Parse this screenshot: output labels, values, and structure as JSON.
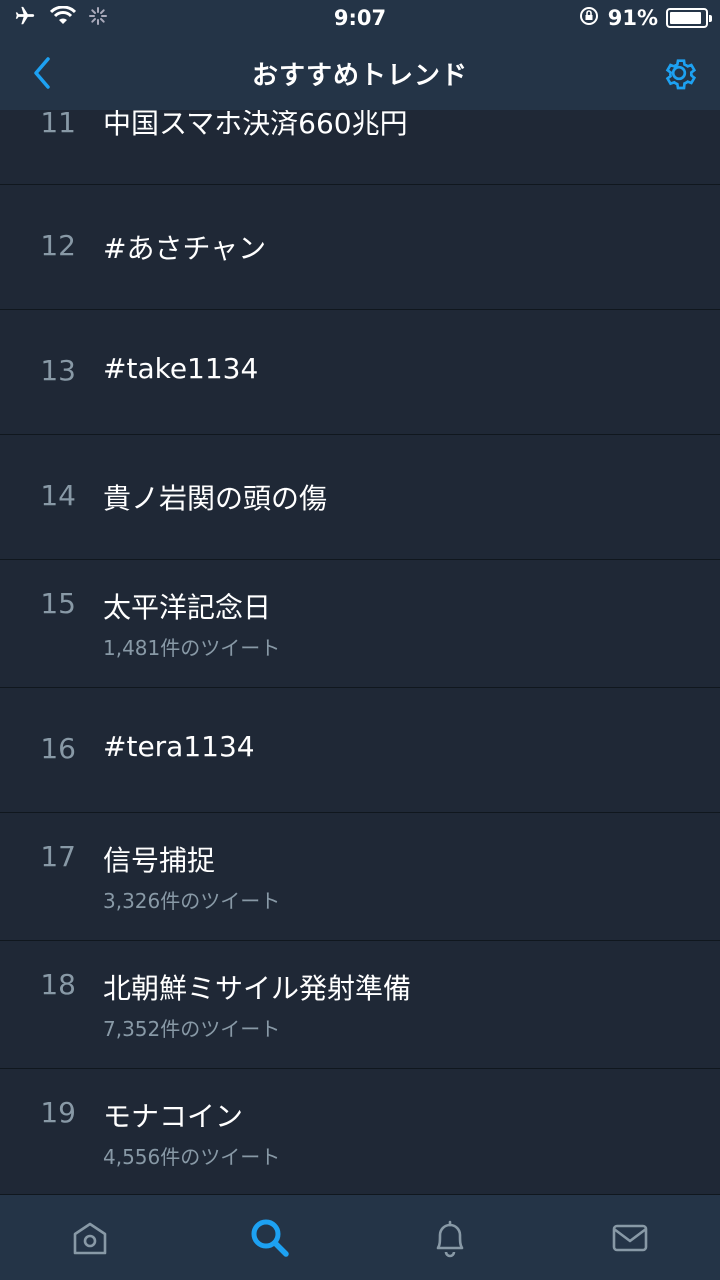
{
  "status_bar": {
    "time": "9:07",
    "battery_percent": "91%",
    "battery_level": 0.91,
    "icons": [
      "airplane-icon",
      "wifi-icon",
      "activity-spinner-icon",
      "orientation-lock-icon",
      "battery-icon"
    ]
  },
  "header": {
    "title": "おすすめトレンド",
    "back_icon": "chevron-left-icon",
    "settings_icon": "gear-icon",
    "accent_color": "#1da1f2"
  },
  "trends": [
    {
      "rank": "11",
      "name": "中国スマホ決済660兆円",
      "count": ""
    },
    {
      "rank": "12",
      "name": "#あさチャン",
      "count": ""
    },
    {
      "rank": "13",
      "name": "#take1134",
      "count": ""
    },
    {
      "rank": "14",
      "name": "貴ノ岩関の頭の傷",
      "count": ""
    },
    {
      "rank": "15",
      "name": "太平洋記念日",
      "count": "1,481件のツイート"
    },
    {
      "rank": "16",
      "name": "#tera1134",
      "count": ""
    },
    {
      "rank": "17",
      "name": "信号捕捉",
      "count": "3,326件のツイート"
    },
    {
      "rank": "18",
      "name": "北朝鮮ミサイル発射準備",
      "count": "7,352件のツイート"
    },
    {
      "rank": "19",
      "name": "モナコイン",
      "count": "4,556件のツイート"
    }
  ],
  "tab_bar": {
    "tabs": [
      {
        "icon": "home-icon",
        "active": false
      },
      {
        "icon": "search-icon",
        "active": true
      },
      {
        "icon": "bell-icon",
        "active": false
      },
      {
        "icon": "mail-icon",
        "active": false
      }
    ]
  }
}
